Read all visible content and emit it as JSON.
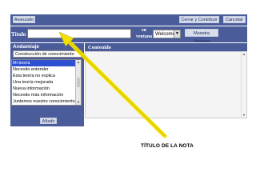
{
  "toolbar": {
    "advanced_label": "Avanzado",
    "close_contribute_label": "Cerrar y Contribuir",
    "cancel_label": "Cancelar"
  },
  "title_row": {
    "label": "Título",
    "input_value": "",
    "en_line1": "en",
    "en_line2": "ventana",
    "selected_window": "Welcome",
    "show_window_label": "Muestra Ventana"
  },
  "sidebar": {
    "title": "Andamiaje",
    "selected_scaffold": "Construcción de conocimiento",
    "items": [
      "Mi teoría",
      "Necesito entender",
      "Esta teoría no explica",
      "Una teoría mejorada",
      "Nueva información",
      "Necesito más información",
      "Juntemos nuestro conocimiento"
    ],
    "selected_index": 0,
    "add_label": "Añadir"
  },
  "content": {
    "title": "Contenido",
    "text": ""
  },
  "annotation": {
    "label": "TÍTULO DE LA NOTA",
    "arrow_color": "#f5e000"
  },
  "colors": {
    "panel_blue": "#4a5d9a",
    "button_bg": "#d7ddeb",
    "selection_blue": "#2f50d0"
  }
}
